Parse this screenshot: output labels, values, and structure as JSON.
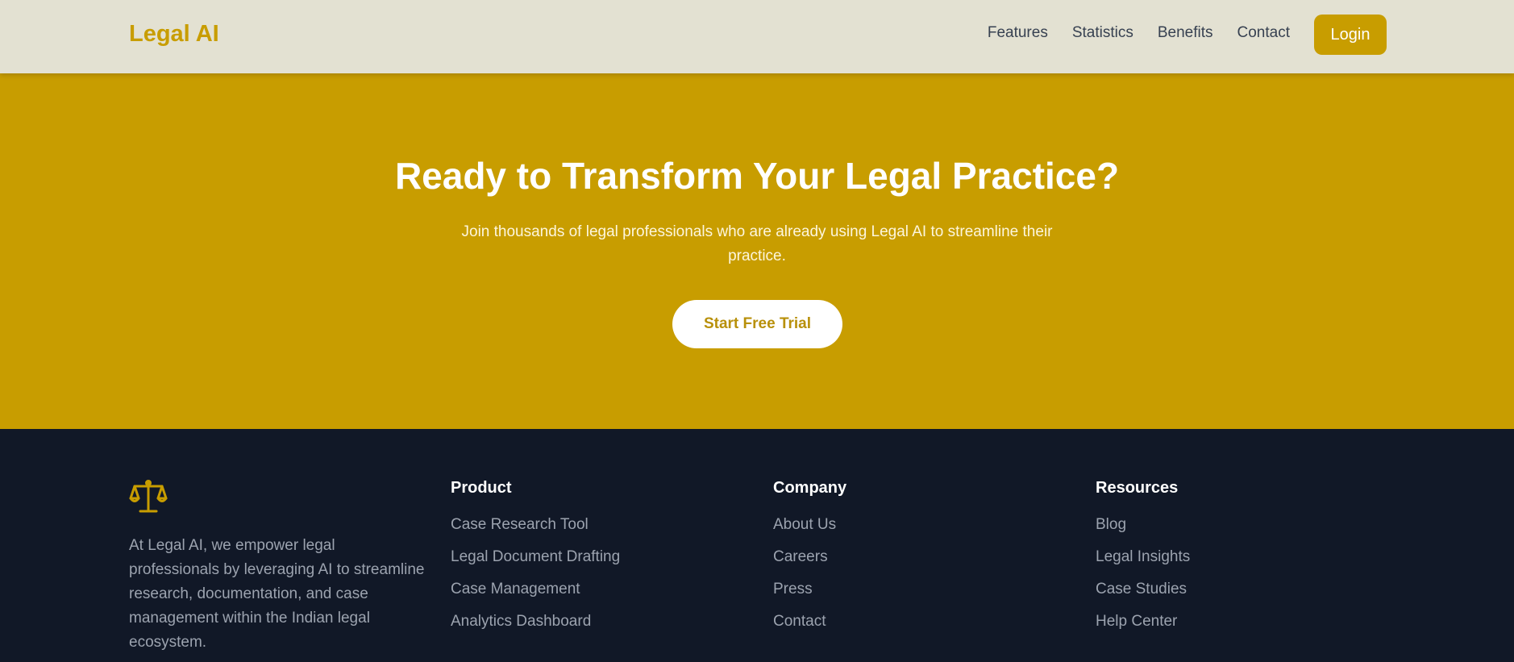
{
  "nav": {
    "brand": "Legal AI",
    "links": [
      "Features",
      "Statistics",
      "Benefits",
      "Contact"
    ],
    "login": "Login"
  },
  "hero": {
    "title": "Ready to Transform Your Legal Practice?",
    "subtitle": "Join thousands of legal professionals who are already using Legal AI to streamline their practice.",
    "cta": "Start Free Trial"
  },
  "footer": {
    "logo_icon": "scale-icon",
    "about": "At Legal AI, we empower legal professionals by leveraging AI to streamline research, documentation, and case management within the Indian legal ecosystem.",
    "columns": [
      {
        "title": "Product",
        "links": [
          "Case Research Tool",
          "Legal Document Drafting",
          "Case Management",
          "Analytics Dashboard"
        ]
      },
      {
        "title": "Company",
        "links": [
          "About Us",
          "Careers",
          "Press",
          "Contact"
        ]
      },
      {
        "title": "Resources",
        "links": [
          "Blog",
          "Legal Insights",
          "Case Studies",
          "Help Center"
        ]
      }
    ]
  },
  "colors": {
    "accent": "#c89d00",
    "nav_bg": "#e3e1d2",
    "footer_bg": "#111827"
  }
}
